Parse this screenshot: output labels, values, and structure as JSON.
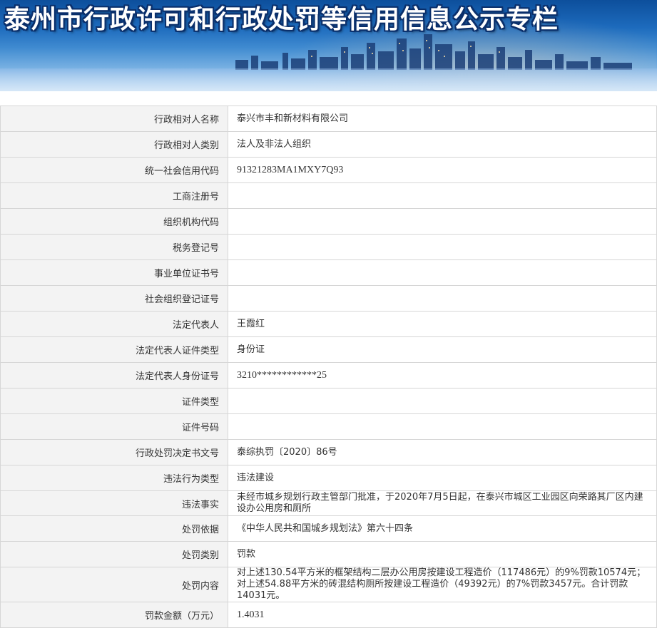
{
  "header": {
    "title": "泰州市行政许可和行政处罚等信用信息公示专栏"
  },
  "record": {
    "rows": [
      {
        "label": "行政相对人名称",
        "value": "泰兴市丰和新材料有限公司"
      },
      {
        "label": "行政相对人类别",
        "value": "法人及非法人组织"
      },
      {
        "label": "统一社会信用代码",
        "value": "91321283MA1MXY7Q93"
      },
      {
        "label": "工商注册号",
        "value": ""
      },
      {
        "label": "组织机构代码",
        "value": ""
      },
      {
        "label": "税务登记号",
        "value": ""
      },
      {
        "label": "事业单位证书号",
        "value": ""
      },
      {
        "label": "社会组织登记证号",
        "value": ""
      },
      {
        "label": "法定代表人",
        "value": "王霞红"
      },
      {
        "label": "法定代表人证件类型",
        "value": "身份证"
      },
      {
        "label": "法定代表人身份证号",
        "value": "3210************25"
      },
      {
        "label": "证件类型",
        "value": ""
      },
      {
        "label": "证件号码",
        "value": ""
      },
      {
        "label": "行政处罚决定书文号",
        "value": "泰综执罚〔2020〕86号"
      },
      {
        "label": "违法行为类型",
        "value": "违法建设"
      },
      {
        "label": "违法事实",
        "value": "未经市城乡规划行政主管部门批准，于2020年7月5日起，在泰兴市城区工业园区向荣路其厂区内建设办公用房和厕所"
      },
      {
        "label": "处罚依据",
        "value": "《中华人民共和国城乡规划法》第六十四条"
      },
      {
        "label": "处罚类别",
        "value": "罚款"
      },
      {
        "label": "处罚内容",
        "value": "对上述130.54平方米的框架结构二层办公用房按建设工程造价（117486元）的9%罚款10574元；对上述54.88平方米的砖混结构厕所按建设工程造价（49392元）的7%罚款3457元。合计罚款14031元。"
      },
      {
        "label": "罚款金额（万元）",
        "value": "1.4031"
      }
    ]
  }
}
